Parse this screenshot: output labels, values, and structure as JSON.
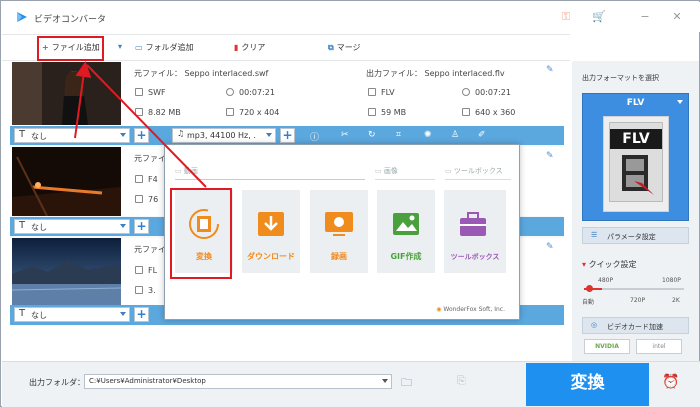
{
  "window": {
    "title": "ビデオコンバータ"
  },
  "toolbar": {
    "add_file": "ファイル追加",
    "add_folder": "フォルダ追加",
    "clear": "クリア",
    "merge": "マージ"
  },
  "files": [
    {
      "source_label": "元ファイル：",
      "source_name": "Seppo interlaced.swf",
      "src_format": "SWF",
      "src_duration": "00:07:21",
      "src_size": "8.82 MB",
      "src_res": "720 x 404",
      "output_label": "出力ファイル：",
      "output_name": "Seppo interlaced.flv",
      "out_format": "FLV",
      "out_duration": "00:07:21",
      "out_size": "59 MB",
      "out_res": "640 x 360",
      "subtitle": "なし",
      "audio": "mp3, 44100 Hz, ."
    },
    {
      "source_label": "元ファイル",
      "src_format": "F4",
      "src_size": "76",
      "subtitle": "なし"
    },
    {
      "source_label": "元ファイル",
      "src_format": "FL",
      "src_size": "3.",
      "subtitle": "なし"
    }
  ],
  "popup": {
    "section_video": "動画",
    "section_image": "画像",
    "section_toolbox": "ツールボックス",
    "tiles": [
      {
        "label": "変換",
        "color": "#f08b1d"
      },
      {
        "label": "ダウンロード",
        "color": "#f08b1d"
      },
      {
        "label": "録画",
        "color": "#f08b1d"
      },
      {
        "label": "GIF作成",
        "color": "#4aa03c"
      },
      {
        "label": "ツールボックス",
        "color": "#9b59b6"
      }
    ],
    "brand": "WonderFox Soft, Inc."
  },
  "right_panel": {
    "format_title": "出力フォーマットを選択",
    "format_value": "FLV",
    "format_icon_text": "FLV",
    "param_button": "パラメータ設定",
    "quick_label": "クイック設定",
    "quality_top": [
      "480P",
      "1080P"
    ],
    "quality_bottom": [
      "自動",
      "720P",
      "2K"
    ],
    "gpu_label": "ビデオカード加速",
    "gpu_brands": [
      "NVIDIA",
      "intel"
    ]
  },
  "bottom": {
    "folder_label": "出力フォルダ：",
    "folder_path": "C:¥Users¥Administrator¥Desktop",
    "convert_label": "変換"
  },
  "colors": {
    "accent": "#1e90f0",
    "highlight": "#e01a22",
    "bar": "#5ba8df"
  }
}
